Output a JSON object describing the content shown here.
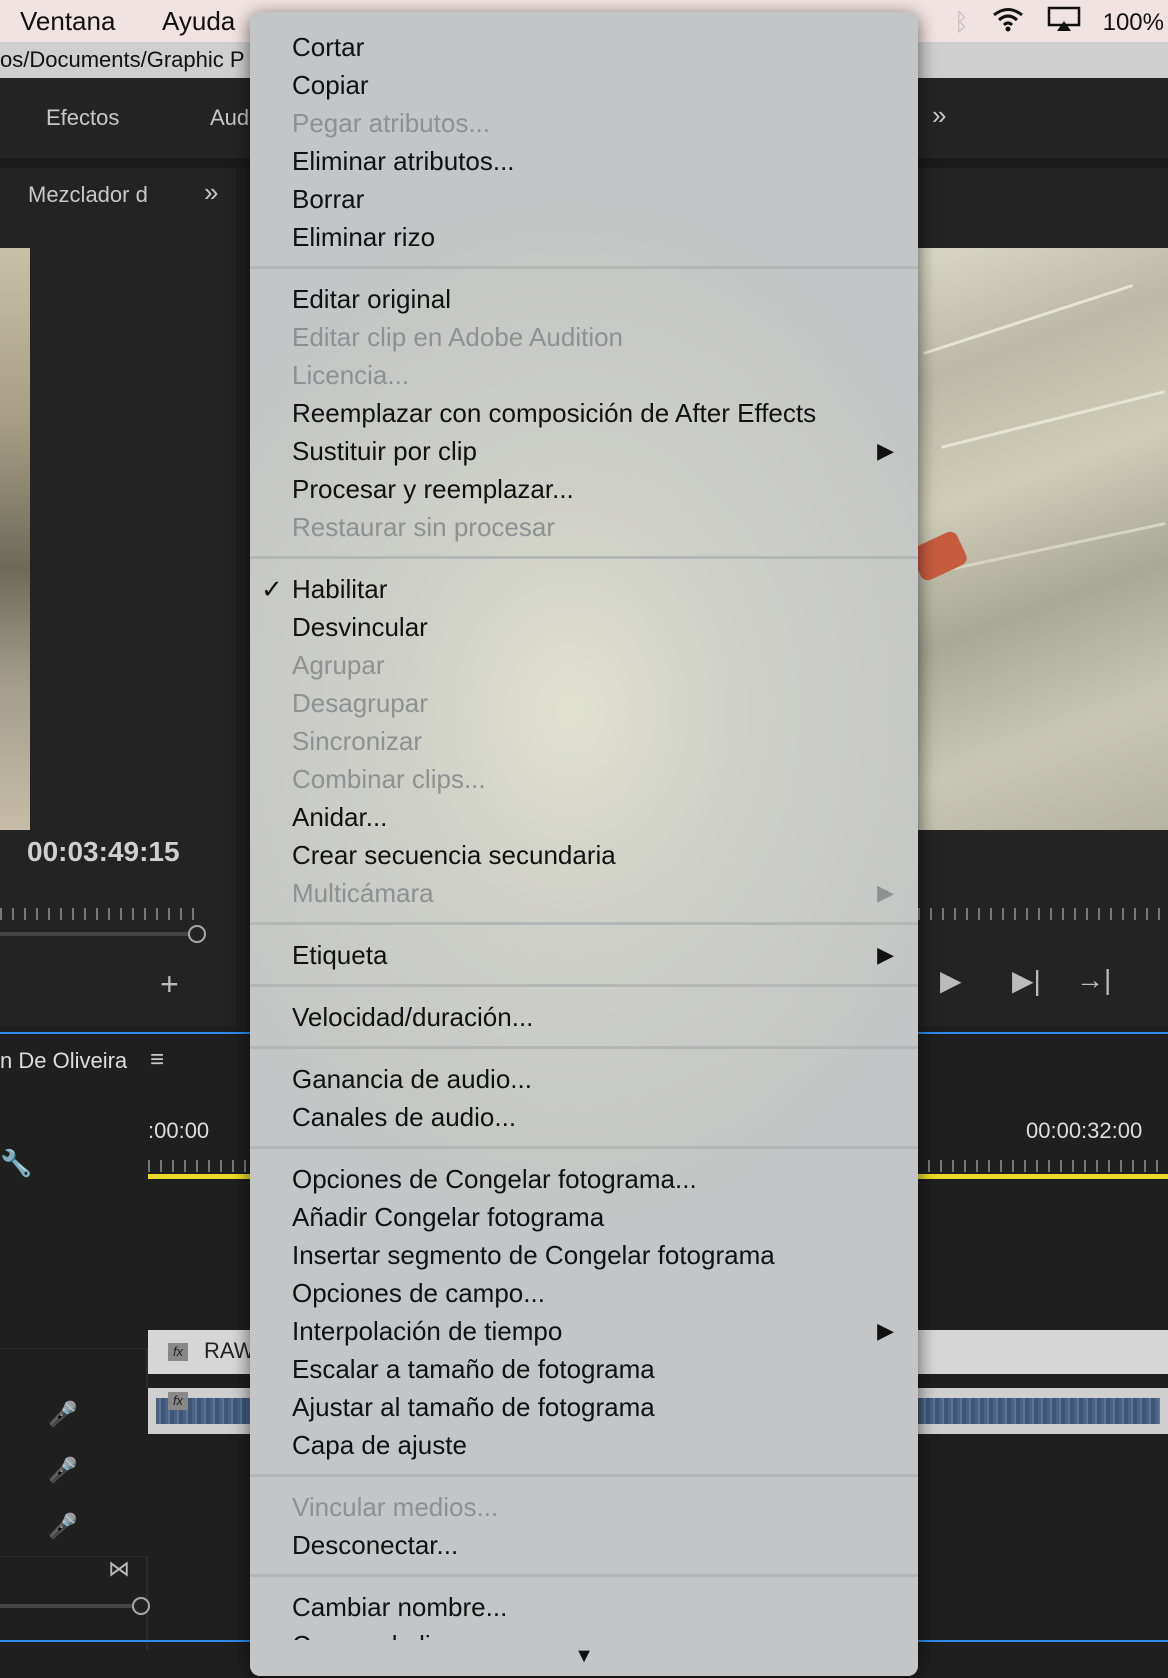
{
  "menubar": {
    "items": [
      "Ventana",
      "Ayuda"
    ],
    "battery": "100%"
  },
  "path_bar": "os/Documents/Graphic P",
  "panels": {
    "effects_tab": "Efectos",
    "audio_tab": "Aud",
    "mixer_tab": "Mezclador d",
    "source_timecode": "00:03:49:15"
  },
  "timeline": {
    "sequence_name": "n De Oliveira",
    "time_start": ":00:00",
    "time_end": "00:00:32:00",
    "clip_label": "RAW"
  },
  "context_menu": {
    "items": [
      {
        "label": "Cortar",
        "enabled": true
      },
      {
        "label": "Copiar",
        "enabled": true
      },
      {
        "label": "Pegar atributos...",
        "enabled": false
      },
      {
        "label": "Eliminar atributos...",
        "enabled": true
      },
      {
        "label": "Borrar",
        "enabled": true
      },
      {
        "label": "Eliminar rizo",
        "enabled": true
      },
      {
        "separator": true
      },
      {
        "label": "Editar original",
        "enabled": true
      },
      {
        "label": "Editar clip en Adobe Audition",
        "enabled": false
      },
      {
        "label": "Licencia...",
        "enabled": false
      },
      {
        "label": "Reemplazar con composición de After Effects",
        "enabled": true
      },
      {
        "label": "Sustituir por clip",
        "enabled": true,
        "submenu": true
      },
      {
        "label": "Procesar y reemplazar...",
        "enabled": true
      },
      {
        "label": "Restaurar sin procesar",
        "enabled": false
      },
      {
        "separator": true
      },
      {
        "label": "Habilitar",
        "enabled": true,
        "checked": true
      },
      {
        "label": "Desvincular",
        "enabled": true
      },
      {
        "label": "Agrupar",
        "enabled": false
      },
      {
        "label": "Desagrupar",
        "enabled": false
      },
      {
        "label": "Sincronizar",
        "enabled": false
      },
      {
        "label": "Combinar clips...",
        "enabled": false
      },
      {
        "label": "Anidar...",
        "enabled": true
      },
      {
        "label": "Crear secuencia secundaria",
        "enabled": true
      },
      {
        "label": "Multicámara",
        "enabled": false,
        "submenu": true
      },
      {
        "separator": true
      },
      {
        "label": "Etiqueta",
        "enabled": true,
        "submenu": true
      },
      {
        "separator": true
      },
      {
        "label": "Velocidad/duración...",
        "enabled": true
      },
      {
        "separator": true
      },
      {
        "label": "Ganancia de audio...",
        "enabled": true
      },
      {
        "label": "Canales de audio...",
        "enabled": true
      },
      {
        "separator": true
      },
      {
        "label": "Opciones de Congelar fotograma...",
        "enabled": true
      },
      {
        "label": "Añadir Congelar fotograma",
        "enabled": true
      },
      {
        "label": "Insertar segmento de Congelar fotograma",
        "enabled": true
      },
      {
        "label": "Opciones de campo...",
        "enabled": true
      },
      {
        "label": "Interpolación de tiempo",
        "enabled": true,
        "submenu": true
      },
      {
        "label": "Escalar a tamaño de fotograma",
        "enabled": true
      },
      {
        "label": "Ajustar al tamaño de fotograma",
        "enabled": true
      },
      {
        "label": "Capa de ajuste",
        "enabled": true
      },
      {
        "separator": true
      },
      {
        "label": "Vincular medios...",
        "enabled": false
      },
      {
        "label": "Desconectar...",
        "enabled": true
      },
      {
        "separator": true
      },
      {
        "label": "Cambiar nombre...",
        "enabled": true
      },
      {
        "label": "Crear subclip",
        "enabled": true
      }
    ],
    "check_glyph": "✓",
    "submenu_glyph": "▶",
    "scroll_glyph": "▼"
  }
}
